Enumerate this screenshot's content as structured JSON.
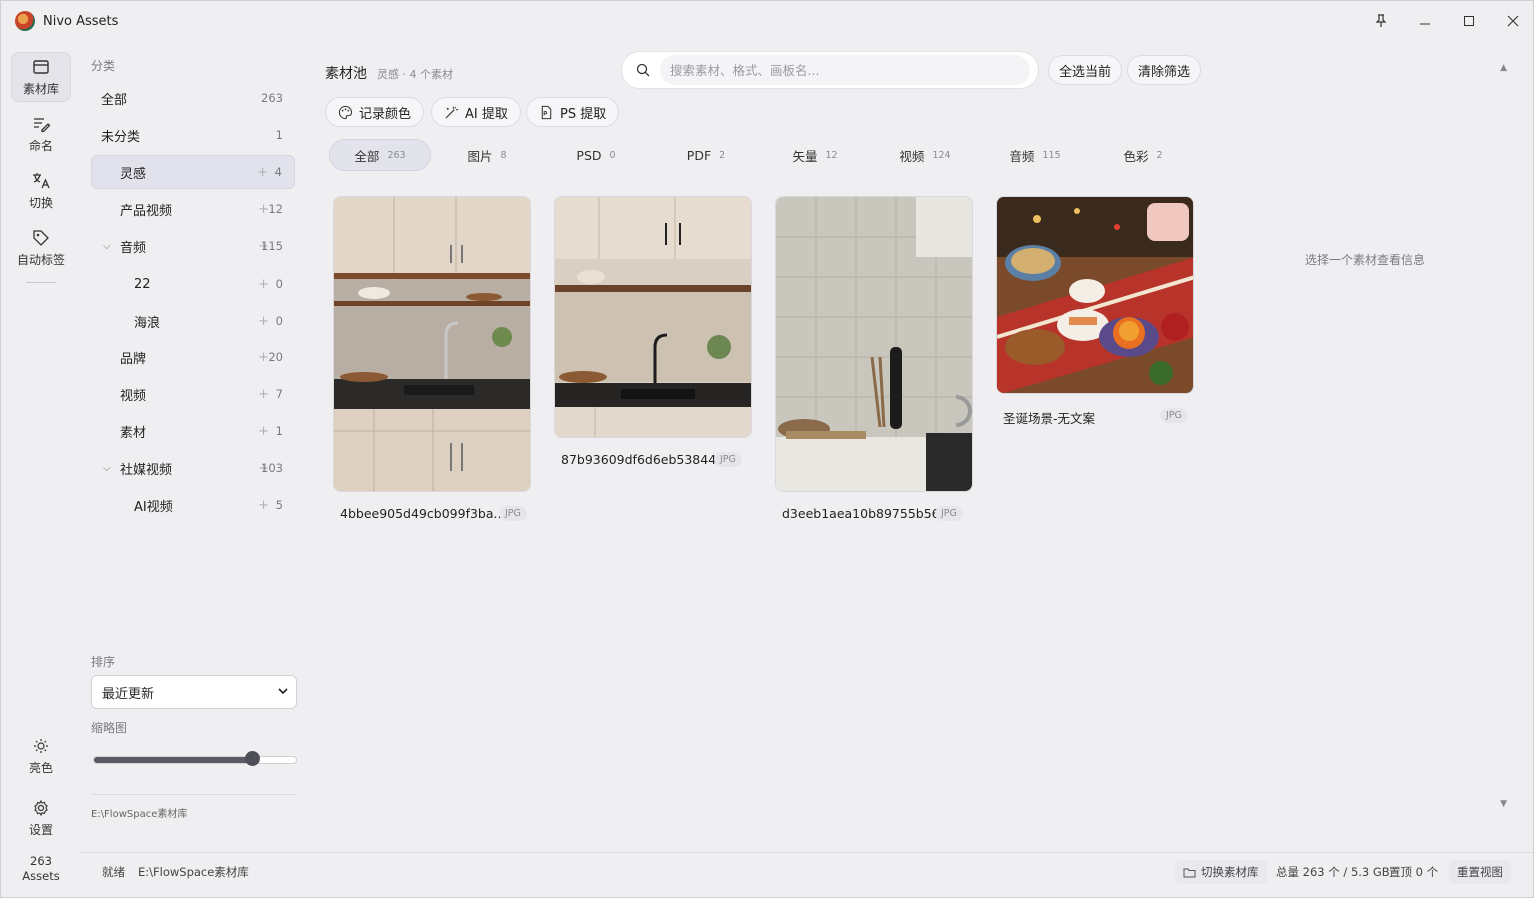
{
  "app": {
    "title": "Nivo Assets"
  },
  "rail": {
    "items": [
      {
        "label": "素材库",
        "icon": "library-icon",
        "active": true
      },
      {
        "label": "命名",
        "icon": "rename-icon"
      },
      {
        "label": "切换",
        "icon": "translate-icon"
      },
      {
        "label": "自动标签",
        "icon": "tag-icon"
      }
    ],
    "theme_label": "亮色",
    "settings_label": "设置",
    "asset_count": "263",
    "asset_unit": "Assets"
  },
  "categories": {
    "heading": "分类",
    "items": [
      {
        "name": "全部",
        "count": "263"
      },
      {
        "name": "未分类",
        "count": "1"
      },
      {
        "name": "灵感",
        "count": "4",
        "selected": true
      },
      {
        "name": "产品视频",
        "count": "12"
      },
      {
        "name": "音频",
        "count": "115",
        "expanded": true
      },
      {
        "name": "22",
        "count": "0"
      },
      {
        "name": "海浪",
        "count": "0"
      },
      {
        "name": "品牌",
        "count": "20"
      },
      {
        "name": "视频",
        "count": "7"
      },
      {
        "name": "素材",
        "count": "1"
      },
      {
        "name": "社媒视频",
        "count": "103",
        "expanded": true
      },
      {
        "name": "AI视频",
        "count": "5"
      }
    ],
    "sort_label": "排序",
    "sort_value": "最近更新",
    "thumb_label": "缩略图",
    "thumb_level": 0.78,
    "library_path": "E:\\FlowSpace素材库"
  },
  "main": {
    "title": "素材池",
    "subtitle": "灵感 · 4 个素材",
    "search_placeholder": "搜索素材、格式、画板名...",
    "select_all": "全选当前",
    "clear_filter": "清除筛选",
    "tools": [
      "记录颜色",
      "AI 提取",
      "PS 提取"
    ],
    "tabs": [
      {
        "label": "全部",
        "count": "263",
        "active": true
      },
      {
        "label": "图片",
        "count": "8"
      },
      {
        "label": "PSD",
        "count": "0"
      },
      {
        "label": "PDF",
        "count": "2"
      },
      {
        "label": "矢量",
        "count": "12"
      },
      {
        "label": "视频",
        "count": "124"
      },
      {
        "label": "音频",
        "count": "115"
      },
      {
        "label": "色彩",
        "count": "2"
      }
    ],
    "assets": [
      {
        "name": "4bbee905d49cb099f3ba...",
        "format": "JPG"
      },
      {
        "name": "87b93609df6d6eb53844...",
        "format": "JPG"
      },
      {
        "name": "d3eeb1aea10b89755b56...",
        "format": "JPG"
      },
      {
        "name": "圣诞场景-无文案",
        "format": "JPG"
      }
    ]
  },
  "info": {
    "empty_text": "选择一个素材查看信息"
  },
  "status": {
    "state": "就绪",
    "path": "E:\\FlowSpace素材库",
    "switch_library": "切换素材库",
    "total": "总量 263 个 / 5.3 GB",
    "pinned": "置顶 0 个",
    "reset_view": "重置视图"
  }
}
